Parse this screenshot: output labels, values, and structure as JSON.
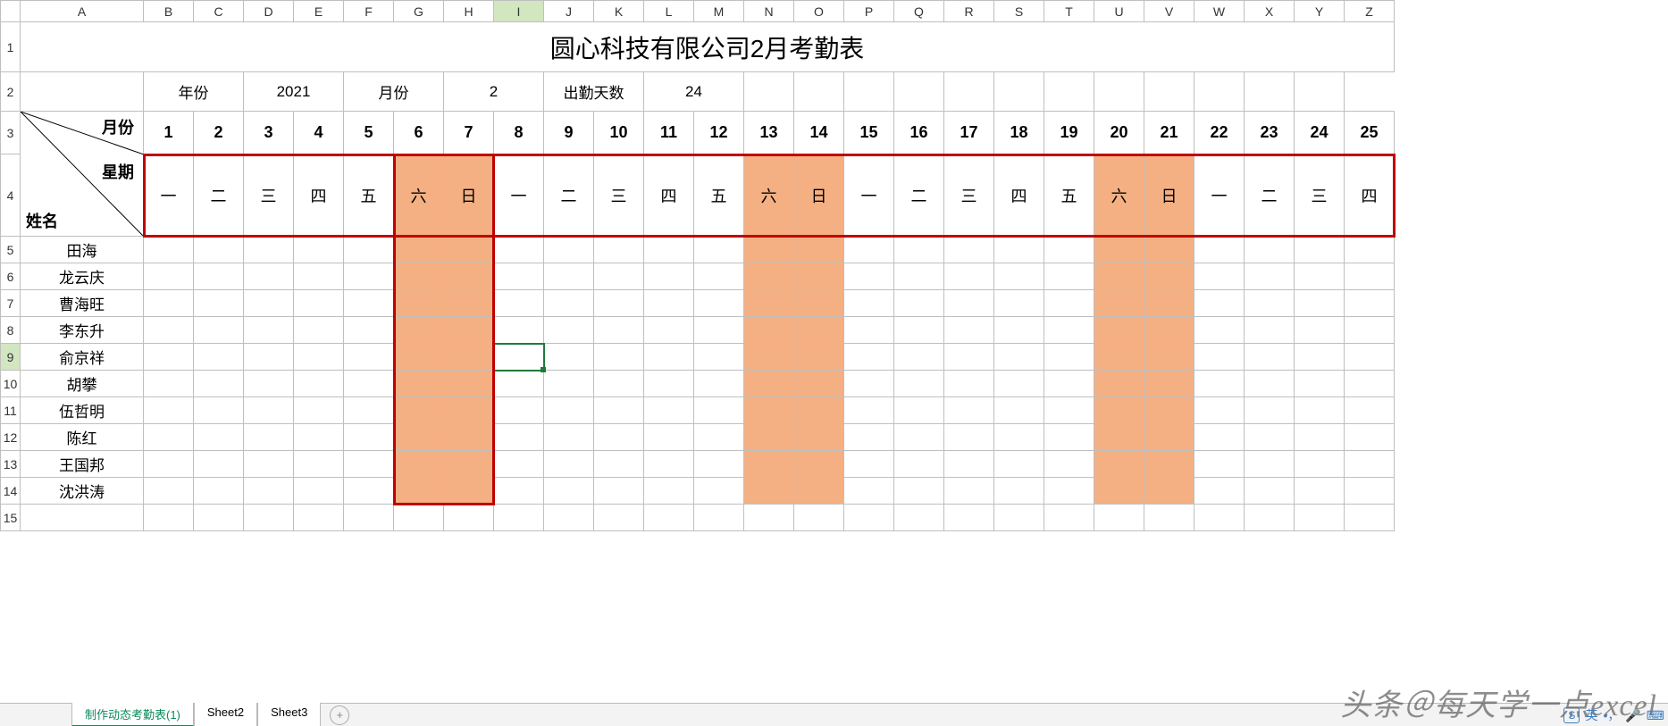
{
  "columns": [
    "A",
    "B",
    "C",
    "D",
    "E",
    "F",
    "G",
    "H",
    "I",
    "J",
    "K",
    "L",
    "M",
    "N",
    "O",
    "P",
    "Q",
    "R",
    "S",
    "T",
    "U",
    "V",
    "W",
    "X",
    "Y",
    "Z"
  ],
  "selected_col": "I",
  "rows": [
    "1",
    "2",
    "3",
    "4",
    "5",
    "6",
    "7",
    "8",
    "9",
    "10",
    "11",
    "12",
    "13",
    "14",
    "15"
  ],
  "selected_row": "9",
  "title": "圆心科技有限公司2月考勤表",
  "info": {
    "year_label": "年份",
    "year_value": "2021",
    "month_label": "月份",
    "month_value": "2",
    "days_label": "出勤天数",
    "days_value": "24"
  },
  "diag": {
    "top": "月份",
    "mid": "星期",
    "bottom": "姓名"
  },
  "day_nums": [
    "1",
    "2",
    "3",
    "4",
    "5",
    "6",
    "7",
    "8",
    "9",
    "10",
    "11",
    "12",
    "13",
    "14",
    "15",
    "16",
    "17",
    "18",
    "19",
    "20",
    "21",
    "22",
    "23",
    "24",
    "25"
  ],
  "weekdays": [
    "一",
    "二",
    "三",
    "四",
    "五",
    "六",
    "日",
    "一",
    "二",
    "三",
    "四",
    "五",
    "六",
    "日",
    "一",
    "二",
    "三",
    "四",
    "五",
    "六",
    "日",
    "一",
    "二",
    "三",
    "四"
  ],
  "weekend_cols": [
    5,
    6,
    12,
    13,
    19,
    20
  ],
  "names": [
    "田海",
    "龙云庆",
    "曹海旺",
    "李东升",
    "俞京祥",
    "胡攀",
    "伍哲明",
    "陈红",
    "王国邦",
    "沈洪涛"
  ],
  "tabs": [
    "制作动态考勤表(1)",
    "Sheet2",
    "Sheet3"
  ],
  "active_tab": 0,
  "watermark": "头条＠每天学一点excel",
  "ime_label": "英"
}
